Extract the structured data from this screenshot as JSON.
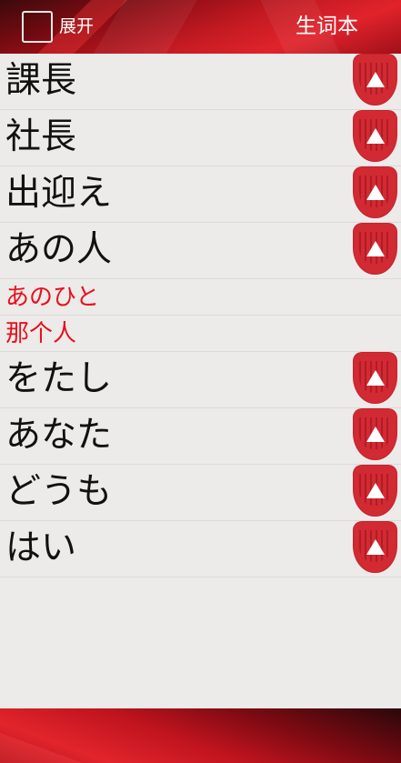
{
  "header": {
    "expand_label": "展开",
    "title": "生词本"
  },
  "list": {
    "items": [
      {
        "word": "課長"
      },
      {
        "word": "社長"
      },
      {
        "word": "出迎え"
      },
      {
        "word": "あの人",
        "reading": "あのひと",
        "meaning": "那个人"
      },
      {
        "word": "をたし"
      },
      {
        "word": "あなた"
      },
      {
        "word": "どうも"
      },
      {
        "word": "はい"
      }
    ]
  },
  "icons": {
    "row_action": "collapse-up-icon"
  },
  "colors": {
    "accent": "#d22a33",
    "detail_text": "#e8101c",
    "background": "#ecebea"
  }
}
